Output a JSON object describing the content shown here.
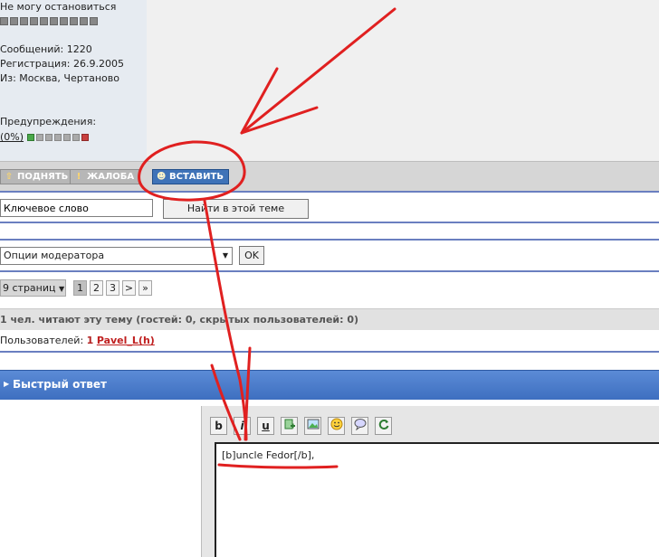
{
  "profile": {
    "status": "Не могу остановиться",
    "posts": "Сообщений: 1220",
    "registered": "Регистрация: 26.9.2005",
    "location": "Из: Москва, Чертаново",
    "warnings_label": "Предупреждения:",
    "warnings_value": "(0%)"
  },
  "actions": {
    "up": "ПОДНЯТЬ",
    "report": "ЖАЛОБА",
    "insert": "ВСТАВИТЬ"
  },
  "search": {
    "keyword_value": "Ключевое слово",
    "button": "Найти в этой теме"
  },
  "moderation": {
    "selected": "Опции модератора",
    "ok": "OK"
  },
  "pagination": {
    "dropdown": "9 страниц",
    "pages": [
      "1",
      "2",
      "3"
    ],
    "next": ">",
    "last": "»"
  },
  "readers": {
    "title": "1 чел. читают эту тему (гостей: 0, скрытых пользователей: 0)",
    "users_label": "Пользователей:",
    "users_count": "1",
    "user_name": "Pavel_L(h)"
  },
  "quick_reply": {
    "title": "Быстрый ответ",
    "text": "[b]uncle Fedor[/b],"
  },
  "toolbar": {
    "bold": "b",
    "italic": "i",
    "underline": "u"
  },
  "annotation_color": "#e02020"
}
